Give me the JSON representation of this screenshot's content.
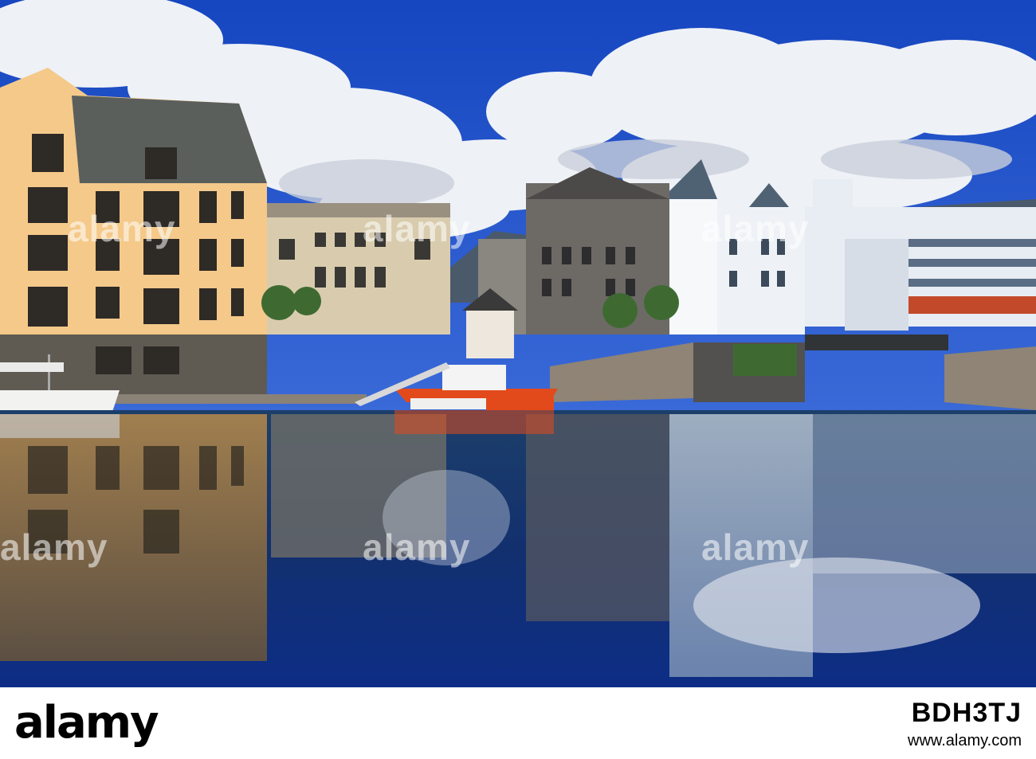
{
  "photo": {
    "description_icon": "harbour-photo",
    "colors": {
      "sky": "#1a4fc6",
      "cloud": "#f2f4f8",
      "water": "#0f2c6b",
      "facade_yellow": "#f4c98a",
      "boat_red": "#e24a1c"
    }
  },
  "watermark": {
    "label": "alamy"
  },
  "footer": {
    "logo": "alamy",
    "site": "www.alamy.com",
    "image_id": "BDH3TJ"
  }
}
